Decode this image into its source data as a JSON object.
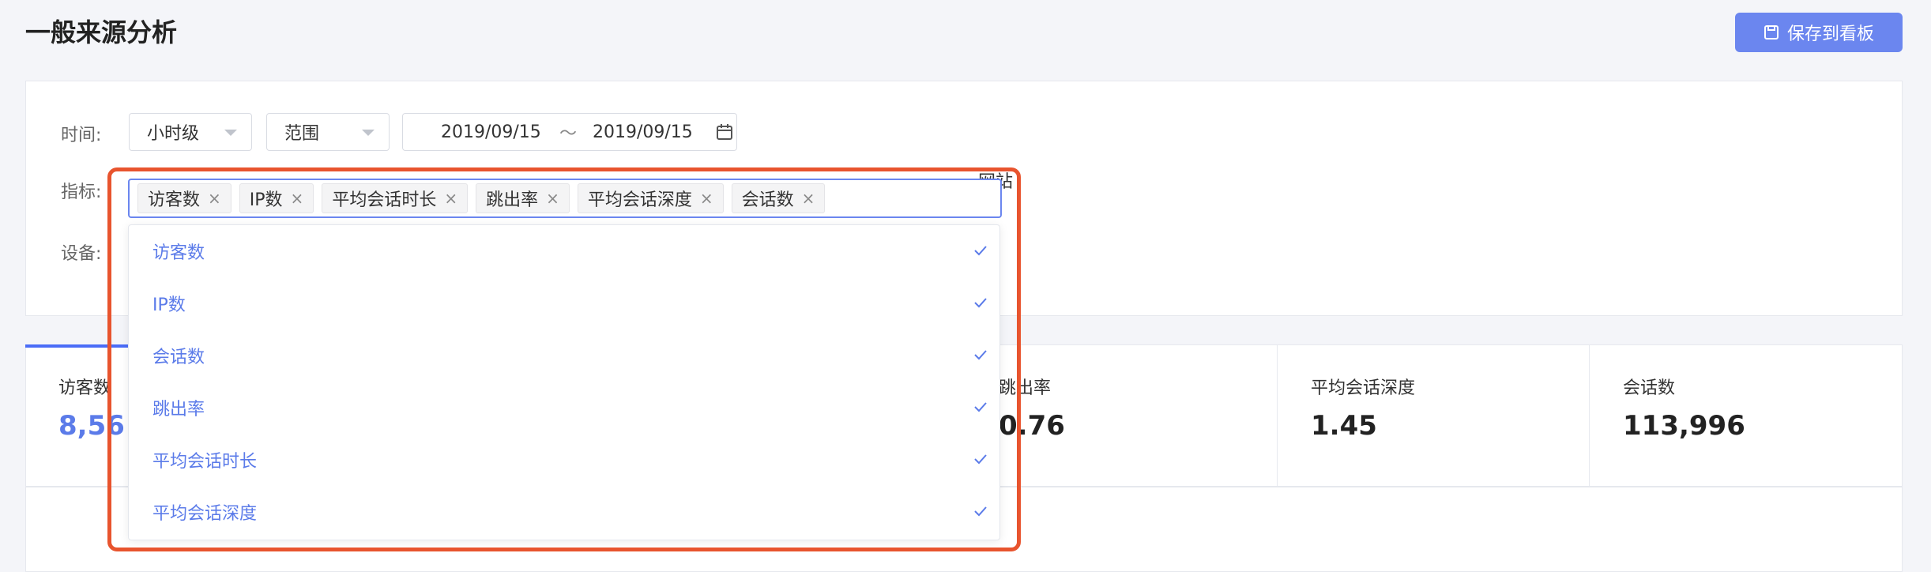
{
  "header": {
    "title": "一般来源分析",
    "save_label": "保存到看板"
  },
  "filters": {
    "time_label": "时间:",
    "metric_label": "指标:",
    "device_label": "设备:",
    "granularity": "小时级",
    "range": "范围",
    "date_start": "2019/09/15",
    "date_sep": "～",
    "date_end": "2019/09/15",
    "device_tail_text": "网站"
  },
  "selected_tags": [
    "访客数",
    "IP数",
    "平均会话时长",
    "跳出率",
    "平均会话深度",
    "会话数"
  ],
  "dropdown_options": [
    {
      "label": "访客数",
      "checked": true
    },
    {
      "label": "IP数",
      "checked": true
    },
    {
      "label": "会话数",
      "checked": true
    },
    {
      "label": "跳出率",
      "checked": true
    },
    {
      "label": "平均会话时长",
      "checked": true
    },
    {
      "label": "平均会话深度",
      "checked": true
    }
  ],
  "metrics": [
    {
      "label": "访客数",
      "value": "8,56"
    },
    {
      "label": "跳出率",
      "value": "0.76"
    },
    {
      "label": "平均会话深度",
      "value": "1.45"
    },
    {
      "label": "会话数",
      "value": "113,996"
    }
  ],
  "colors": {
    "primary": "#5b7be9",
    "button": "#6b86ef",
    "highlight": "#e8542e"
  }
}
